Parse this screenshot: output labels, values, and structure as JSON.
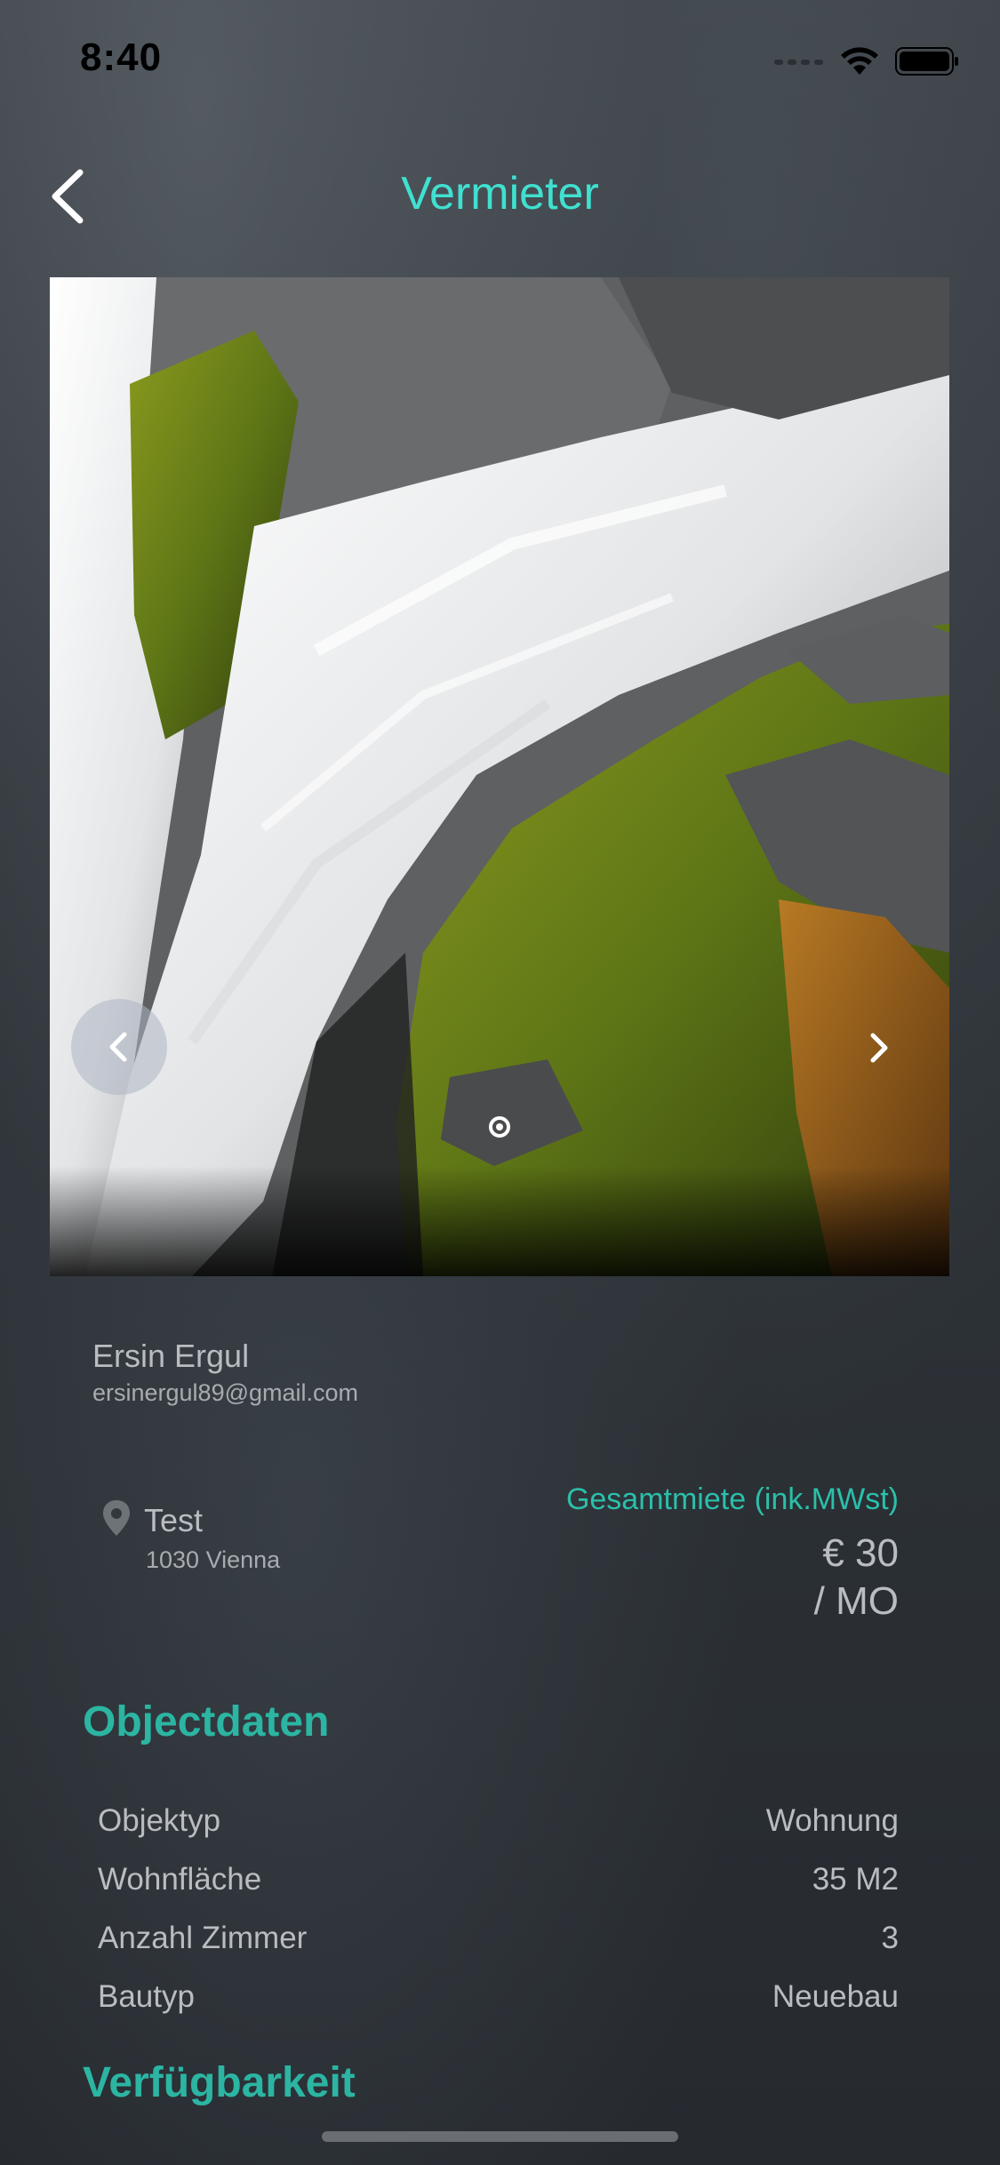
{
  "status_bar": {
    "time": "8:40",
    "icons": [
      "signal-icon",
      "wifi-icon",
      "battery-icon"
    ]
  },
  "nav": {
    "title": "Vermieter",
    "back_icon": "chevron-left-icon"
  },
  "carousel": {
    "image": "waterfall-mossy-rocks-photo",
    "prev_icon": "chevron-left-icon",
    "next_icon": "chevron-right-icon",
    "page_index": 1,
    "page_count": 1
  },
  "owner": {
    "name": "Ersin Ergul",
    "email": "ersinergul89@gmail.com"
  },
  "location": {
    "icon": "location-pin-icon",
    "name": "Test",
    "city": "1030 Vienna"
  },
  "rent": {
    "label": "Gesamtmiete (ink.MWst)",
    "amount": "€ 30",
    "unit": "/ MO"
  },
  "object_section": {
    "title": "Objectdaten",
    "rows": [
      {
        "label": "Objektyp",
        "value": "Wohnung"
      },
      {
        "label": "Wohnfläche",
        "value": "35 M2"
      },
      {
        "label": "Anzahl Zimmer",
        "value": "3"
      },
      {
        "label": "Bautyp",
        "value": "Neuebau"
      }
    ]
  },
  "availability_section": {
    "title": "Verfügbarkeit"
  },
  "colors": {
    "accent": "#40e0d0",
    "section_heading": "#2bb5a2",
    "background": "#2d3237"
  }
}
